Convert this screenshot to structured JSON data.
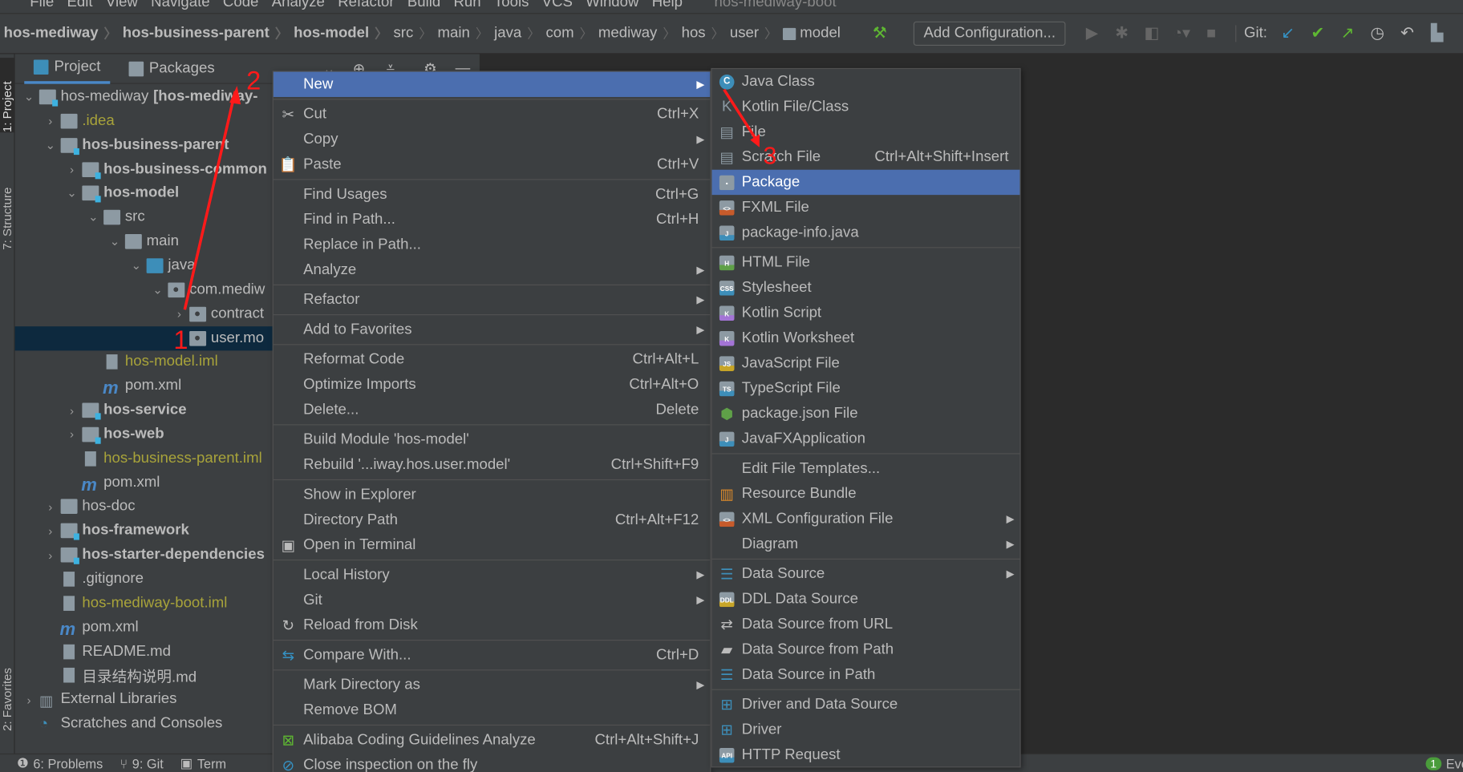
{
  "menubar": {
    "items": [
      "File",
      "Edit",
      "View",
      "Navigate",
      "Code",
      "Analyze",
      "Refactor",
      "Build",
      "Run",
      "Tools",
      "VCS",
      "Window",
      "Help"
    ],
    "window_title": "hos-mediway-boot"
  },
  "breadcrumb": [
    {
      "label": "hos-mediway",
      "bold": true
    },
    {
      "label": "hos-business-parent",
      "bold": true
    },
    {
      "label": "hos-model",
      "bold": true
    },
    {
      "label": "src"
    },
    {
      "label": "main"
    },
    {
      "label": "java"
    },
    {
      "label": "com"
    },
    {
      "label": "mediway"
    },
    {
      "label": "hos"
    },
    {
      "label": "user"
    },
    {
      "label": "model",
      "icon": "package-folder-icon"
    }
  ],
  "toolbar": {
    "add_configuration": "Add Configuration...",
    "git_label": "Git:"
  },
  "side_tabs": {
    "project": "1: Project",
    "structure": "7: Structure",
    "favorites": "2: Favorites"
  },
  "project_panel": {
    "tabs": [
      "Project",
      "Packages"
    ],
    "tree": [
      {
        "label": "hos-mediway",
        "suffix": "[hos-mediway-",
        "level": 0,
        "state": "open",
        "icon": "module-folder",
        "bold": false
      },
      {
        "label": ".idea",
        "level": 1,
        "state": "closed",
        "icon": "folder",
        "color": "olive"
      },
      {
        "label": "hos-business-parent",
        "level": 1,
        "state": "open",
        "icon": "module-folder",
        "bold": true
      },
      {
        "label": "hos-business-common",
        "level": 2,
        "state": "closed",
        "icon": "module-folder",
        "bold": true
      },
      {
        "label": "hos-model",
        "level": 2,
        "state": "open",
        "icon": "module-folder",
        "bold": true
      },
      {
        "label": "src",
        "level": 3,
        "state": "open",
        "icon": "folder"
      },
      {
        "label": "main",
        "level": 4,
        "state": "open",
        "icon": "folder"
      },
      {
        "label": "java",
        "level": 5,
        "state": "open",
        "icon": "source-folder"
      },
      {
        "label": "com.mediw",
        "level": 6,
        "state": "open",
        "icon": "package"
      },
      {
        "label": "contract",
        "level": 7,
        "state": "closed",
        "icon": "package"
      },
      {
        "label": "user.mo",
        "level": 7,
        "state": "none",
        "icon": "package",
        "selected": true
      },
      {
        "label": "hos-model.iml",
        "level": 3,
        "state": "none",
        "icon": "file",
        "color": "olive"
      },
      {
        "label": "pom.xml",
        "level": 3,
        "state": "none",
        "icon": "maven"
      },
      {
        "label": "hos-service",
        "level": 2,
        "state": "closed",
        "icon": "module-folder",
        "bold": true
      },
      {
        "label": "hos-web",
        "level": 2,
        "state": "closed",
        "icon": "module-folder",
        "bold": true
      },
      {
        "label": "hos-business-parent.iml",
        "level": 2,
        "state": "none",
        "icon": "file",
        "color": "olive"
      },
      {
        "label": "pom.xml",
        "level": 2,
        "state": "none",
        "icon": "maven"
      },
      {
        "label": "hos-doc",
        "level": 1,
        "state": "closed",
        "icon": "folder"
      },
      {
        "label": "hos-framework",
        "level": 1,
        "state": "closed",
        "icon": "module-folder",
        "bold": true
      },
      {
        "label": "hos-starter-dependencies",
        "level": 1,
        "state": "closed",
        "icon": "module-folder",
        "bold": true
      },
      {
        "label": ".gitignore",
        "level": 1,
        "state": "none",
        "icon": "file"
      },
      {
        "label": "hos-mediway-boot.iml",
        "level": 1,
        "state": "none",
        "icon": "file",
        "color": "olive"
      },
      {
        "label": "pom.xml",
        "level": 1,
        "state": "none",
        "icon": "maven"
      },
      {
        "label": "README.md",
        "level": 1,
        "state": "none",
        "icon": "md"
      },
      {
        "label": "目录结构说明.md",
        "level": 1,
        "state": "none",
        "icon": "md"
      },
      {
        "label": "External Libraries",
        "level": 0,
        "state": "closed",
        "icon": "libraries"
      },
      {
        "label": "Scratches and Consoles",
        "level": 0,
        "state": "none",
        "icon": "scratches"
      }
    ]
  },
  "context_menu": [
    {
      "label": "New",
      "submenu": true,
      "highlighted": true
    },
    "sep",
    {
      "label": "Cut",
      "shortcut": "Ctrl+X",
      "icon": "scissors"
    },
    {
      "label": "Copy",
      "submenu": true
    },
    {
      "label": "Paste",
      "shortcut": "Ctrl+V",
      "icon": "clipboard"
    },
    "sep",
    {
      "label": "Find Usages",
      "shortcut": "Ctrl+G"
    },
    {
      "label": "Find in Path...",
      "shortcut": "Ctrl+H"
    },
    {
      "label": "Replace in Path..."
    },
    {
      "label": "Analyze",
      "submenu": true
    },
    "sep",
    {
      "label": "Refactor",
      "submenu": true
    },
    "sep",
    {
      "label": "Add to Favorites",
      "submenu": true
    },
    "sep",
    {
      "label": "Reformat Code",
      "shortcut": "Ctrl+Alt+L"
    },
    {
      "label": "Optimize Imports",
      "shortcut": "Ctrl+Alt+O"
    },
    {
      "label": "Delete...",
      "shortcut": "Delete"
    },
    "sep",
    {
      "label": "Build Module 'hos-model'"
    },
    {
      "label": "Rebuild '...iway.hos.user.model'",
      "shortcut": "Ctrl+Shift+F9"
    },
    "sep",
    {
      "label": "Show in Explorer"
    },
    {
      "label": "Directory Path",
      "shortcut": "Ctrl+Alt+F12"
    },
    {
      "label": "Open in Terminal",
      "icon": "terminal"
    },
    "sep",
    {
      "label": "Local History",
      "submenu": true
    },
    {
      "label": "Git",
      "submenu": true
    },
    {
      "label": "Reload from Disk",
      "icon": "reload"
    },
    "sep",
    {
      "label": "Compare With...",
      "shortcut": "Ctrl+D",
      "icon": "compare"
    },
    "sep",
    {
      "label": "Mark Directory as",
      "submenu": true
    },
    {
      "label": "Remove BOM"
    },
    "sep",
    {
      "label": "Alibaba Coding Guidelines Analyze",
      "shortcut": "Ctrl+Alt+Shift+J",
      "icon": "alibaba"
    },
    {
      "label": "Close inspection on the fly",
      "icon": "no-inspection"
    }
  ],
  "new_submenu": [
    {
      "label": "Java Class",
      "icon": "java-class"
    },
    {
      "label": "Kotlin File/Class",
      "icon": "kotlin-file"
    },
    {
      "label": "File",
      "icon": "file"
    },
    {
      "label": "Scratch File",
      "shortcut": "Ctrl+Alt+Shift+Insert",
      "icon": "scratch-file"
    },
    {
      "label": "Package",
      "icon": "package",
      "highlighted": true
    },
    {
      "label": "FXML File",
      "icon": "fxml"
    },
    {
      "label": "package-info.java",
      "icon": "java-file"
    },
    "sep",
    {
      "label": "HTML File",
      "icon": "html"
    },
    {
      "label": "Stylesheet",
      "icon": "css"
    },
    {
      "label": "Kotlin Script",
      "icon": "kotlin"
    },
    {
      "label": "Kotlin Worksheet",
      "icon": "kotlin"
    },
    {
      "label": "JavaScript File",
      "icon": "js"
    },
    {
      "label": "TypeScript File",
      "icon": "ts"
    },
    {
      "label": "package.json File",
      "icon": "nodejs"
    },
    {
      "label": "JavaFXApplication",
      "icon": "java-file"
    },
    "sep",
    {
      "label": "Edit File Templates..."
    },
    {
      "label": "Resource Bundle",
      "icon": "resource-bundle"
    },
    {
      "label": "XML Configuration File",
      "icon": "xml",
      "submenu": true
    },
    {
      "label": "Diagram",
      "submenu": true
    },
    "sep",
    {
      "label": "Data Source",
      "icon": "database",
      "submenu": true
    },
    {
      "label": "DDL Data Source",
      "icon": "ddl"
    },
    {
      "label": "Data Source from URL",
      "icon": "db-url"
    },
    {
      "label": "Data Source from Path",
      "icon": "db-path"
    },
    {
      "label": "Data Source in Path",
      "icon": "database"
    },
    "sep",
    {
      "label": "Driver and Data Source",
      "icon": "driver"
    },
    {
      "label": "Driver",
      "icon": "driver"
    },
    {
      "label": "HTTP Request",
      "icon": "api"
    }
  ],
  "status_bar": {
    "problems": "6: Problems",
    "git": "9: Git",
    "terminal": "Term",
    "event_count": "1",
    "event_log": "Event"
  },
  "annotations": [
    "1",
    "2",
    "3"
  ],
  "colors": {
    "highlight": "#4b6eaf",
    "panel": "#3c3f41",
    "editor": "#2b2b2b",
    "selection": "#0d293e",
    "annotation": "#ff1a1a",
    "olive": "#a8a33a"
  }
}
